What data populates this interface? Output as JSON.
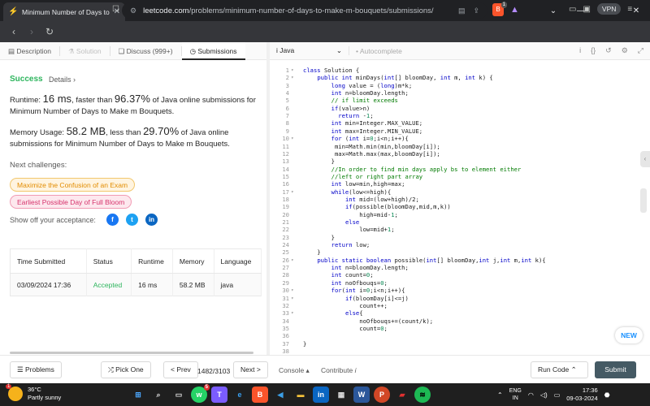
{
  "browser": {
    "tab_title": "Minimum Number of Days to M",
    "url_host": "leetcode.com",
    "url_path": "/problems/minimum-number-of-days-to-make-m-bouquets/submissions/",
    "vpn_label": "VPN",
    "brave_badge": "1"
  },
  "left_tabs": [
    "Description",
    "Solution",
    "Discuss (999+)",
    "Submissions"
  ],
  "result": {
    "status": "Success",
    "details_label": "Details",
    "runtime_label": "Runtime:",
    "runtime_value": "16 ms",
    "runtime_mid": ", faster than ",
    "runtime_pct": "96.37%",
    "runtime_tail": " of Java online submissions for Minimum Number of Days to Make m Bouquets.",
    "memory_label": "Memory Usage:",
    "memory_value": "58.2 MB",
    "memory_mid": ", less than ",
    "memory_pct": "29.70%",
    "memory_tail": " of Java online submissions for Minimum Number of Days to Make m Bouquets."
  },
  "challenges": {
    "heading": "Next challenges:",
    "items": [
      "Maximize the Confusion of an Exam",
      "Earliest Possible Day of Full Bloom"
    ]
  },
  "share": {
    "label": "Show off your acceptance:"
  },
  "submissions_table": {
    "headers": [
      "Time Submitted",
      "Status",
      "Runtime",
      "Memory",
      "Language"
    ],
    "rows": [
      [
        "03/09/2024 17:36",
        "Accepted",
        "16 ms",
        "58.2 MB",
        "java"
      ]
    ]
  },
  "editor": {
    "language": "Java",
    "autocomplete": "Autocomplete",
    "lines": [
      "class Solution {",
      "    public int minDays(int[] bloomDay, int m, int k) {",
      "        long value = (long)m*k;",
      "        int n=bloomDay.length;",
      "        // if limit exceeds",
      "        if(value>n)",
      "          return -1;",
      "        int min=Integer.MAX_VALUE;",
      "        int max=Integer.MIN_VALUE;",
      "        for (int i=0;i<n;i++){",
      "         min=Math.min(min,bloomDay[i]);",
      "         max=Math.max(max,bloomDay[i]);",
      "        }",
      "        //In order to find min days apply bs to element either",
      "        //left or right part array",
      "        int low=min,high=max;",
      "        while(low<=high){",
      "            int mid=(low+high)/2;",
      "            if(possible(bloomDay,mid,m,k))",
      "                high=mid-1;",
      "            else",
      "                low=mid+1;",
      "        }",
      "        return low;",
      "    }",
      "    public static boolean possible(int[] bloomDay,int j,int m,int k){",
      "        int n=bloomDay.length;",
      "        int count=0;",
      "        int noOfbouqs=0;",
      "        for(int i=0;i<n;i++){",
      "            if(bloomDay[i]<=j)",
      "                count++;",
      "            else{",
      "                noOfbouqs+=(count/k);",
      "                count=0;",
      "",
      "}",
      ""
    ],
    "fold_lines": [
      1,
      2,
      10,
      17,
      26,
      30,
      31,
      33
    ]
  },
  "new_badge": "NEW",
  "bottom": {
    "problems": "Problems",
    "pick_one": "Pick One",
    "prev": "< Prev",
    "pager": "1482/3103",
    "next": "Next >",
    "console": "Console",
    "contribute": "Contribute",
    "run_code": "Run Code",
    "submit": "Submit"
  },
  "taskbar": {
    "temp": "36°C",
    "weather": "Partly sunny",
    "weather_badge": "1",
    "lang_top": "ENG",
    "lang_bottom": "IN",
    "time": "17:36",
    "date": "09-03-2024"
  }
}
